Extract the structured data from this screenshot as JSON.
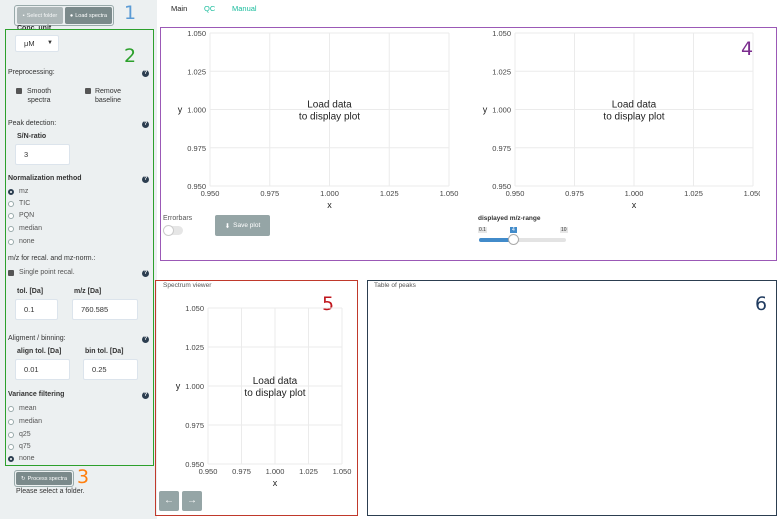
{
  "sidebar": {
    "top_buttons": {
      "select_folder": "Select folder",
      "load_spectra": "Load spectra"
    },
    "conc_unit": {
      "label": "Conc. unit",
      "value": "μM"
    },
    "preprocessing": {
      "label": "Preprocessing:",
      "smooth": "Smooth spectra",
      "smooth_l1": "Smooth",
      "smooth_l2": "spectra",
      "remove_l1": "Remove",
      "remove_l2": "baseline"
    },
    "peak_detection": {
      "label": "Peak detection:",
      "sn_label": "S/N-ratio",
      "sn_value": "3"
    },
    "normalization": {
      "label": "Normalization method",
      "options": [
        "mz",
        "TIC",
        "PQN",
        "median",
        "none"
      ],
      "selected": "mz"
    },
    "recal": {
      "label": "m/z for recal. and mz-norm.:",
      "single_point": "Single point recal.",
      "tol_label": "tol. [Da]",
      "tol_value": "0.1",
      "mz_label": "m/z [Da]",
      "mz_value": "760.585"
    },
    "alignment": {
      "label": "Aligment / binning:",
      "align_label": "align tol. [Da]",
      "align_value": "0.01",
      "bin_label": "bin tol. [Da]",
      "bin_value": "0.25"
    },
    "variance": {
      "label": "Variance filtering",
      "options": [
        "mean",
        "median",
        "q25",
        "q75",
        "none"
      ],
      "selected": "none"
    },
    "process_button": "Process spectra",
    "status": "Please select a folder."
  },
  "tabs": [
    "Main",
    "QC",
    "Manual"
  ],
  "active_tab": "Main",
  "plot_message_l1": "Load data",
  "plot_message_l2": "to display plot",
  "controls": {
    "errorbars_label": "Errorbars",
    "save_plot": "Save plot",
    "mz_range_label": "displayed m/z-range",
    "slider_min": "0.1",
    "slider_value": "4",
    "slider_max": "10"
  },
  "spectrum_viewer": {
    "title": "Spectrum viewer"
  },
  "table_of_peaks": {
    "title": "Table of peaks"
  },
  "annotations": [
    "1",
    "2",
    "3",
    "4",
    "5",
    "6"
  ],
  "colors": {
    "anno1": "#5b9bd5",
    "anno2": "#2ca02c",
    "anno3": "#ff7f0e",
    "anno4": "#7b2d8e",
    "anno5": "#c0161d",
    "anno6": "#1f3a5f"
  },
  "chart_data": [
    {
      "type": "line",
      "title": "",
      "xlabel": "x",
      "ylabel": "y",
      "xlim": [
        0.95,
        1.05
      ],
      "ylim": [
        0.95,
        1.05
      ],
      "xticks": [
        "0.950",
        "0.975",
        "1.000",
        "1.025",
        "1.050"
      ],
      "yticks": [
        "1.050",
        "1.025",
        "1.000",
        "0.975",
        "0.950"
      ],
      "series": []
    },
    {
      "type": "line",
      "title": "",
      "xlabel": "x",
      "ylabel": "y",
      "xlim": [
        0.95,
        1.05
      ],
      "ylim": [
        0.95,
        1.05
      ],
      "xticks": [
        "0.950",
        "0.975",
        "1.000",
        "1.025",
        "1.050"
      ],
      "yticks": [
        "1.050",
        "1.025",
        "1.000",
        "0.975",
        "0.950"
      ],
      "series": []
    },
    {
      "type": "line",
      "title": "",
      "xlabel": "x",
      "ylabel": "y",
      "xlim": [
        0.95,
        1.05
      ],
      "ylim": [
        0.95,
        1.05
      ],
      "xticks": [
        "0.950",
        "0.975",
        "1.000",
        "1.025",
        "1.050"
      ],
      "yticks": [
        "1.050",
        "1.025",
        "1.000",
        "0.975",
        "0.950"
      ],
      "series": []
    }
  ]
}
